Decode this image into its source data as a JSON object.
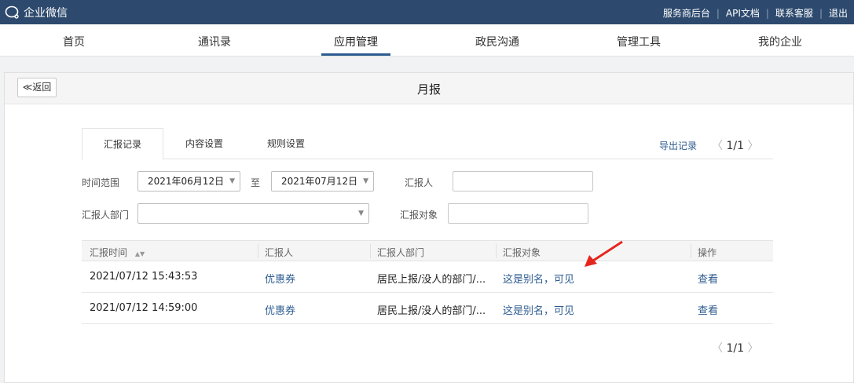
{
  "app": {
    "logo_text": "企业微信"
  },
  "top_links": [
    "服务商后台",
    "API文档",
    "联系客服",
    "退出"
  ],
  "nav": {
    "items": [
      "首页",
      "通讯录",
      "应用管理",
      "政民沟通",
      "管理工具",
      "我的企业"
    ],
    "active": "应用管理"
  },
  "panel": {
    "back_label": "≪返回",
    "title": "月报"
  },
  "tabs": [
    "汇报记录",
    "内容设置",
    "规则设置"
  ],
  "toolbar": {
    "export_label": "导出记录",
    "page": "1/1"
  },
  "filters": {
    "time_range_label": "时间范围",
    "start_date": "2021年06月12日",
    "to_label": "至",
    "end_date": "2021年07月12日",
    "reporter_label": "汇报人",
    "reporter_value": "",
    "department_label": "汇报人部门",
    "department_value": "",
    "target_label": "汇报对象",
    "target_value": ""
  },
  "table": {
    "columns": [
      "汇报时间",
      "汇报人",
      "汇报人部门",
      "汇报对象",
      "操作"
    ],
    "rows": [
      {
        "time": "2021/07/12 15:43:53",
        "reporter": "优惠券",
        "dept": "居民上报/没人的部门/...",
        "target": "这是别名，可见",
        "action": "查看"
      },
      {
        "time": "2021/07/12 14:59:00",
        "reporter": "优惠券",
        "dept": "居民上报/没人的部门/...",
        "target": "这是别名，可见",
        "action": "查看"
      }
    ]
  },
  "pager": {
    "page": "1/1"
  },
  "colors": {
    "topbar": "#2d4a6e",
    "link": "#2d5b8f",
    "annotation_arrow": "#e5261f"
  }
}
